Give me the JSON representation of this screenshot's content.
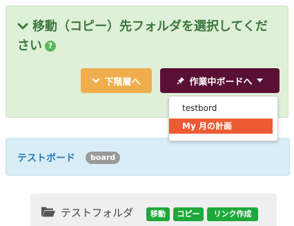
{
  "header": {
    "title": "移動（コピー）先フォルダを選択してください",
    "help": "?",
    "colors": {
      "panel": "#dff0d8",
      "title": "#3c763d"
    }
  },
  "buttons": {
    "down_level": "下階層へ",
    "to_board": "作業中ボードへ"
  },
  "dropdown": {
    "items": [
      "testbord",
      "My 月の計画"
    ],
    "active_index": 1
  },
  "board": {
    "name": "テストボード",
    "tag": "board"
  },
  "folder": {
    "name": "テストフォルダ",
    "actions": [
      "移動",
      "コピー",
      "リンク作成"
    ]
  },
  "icons": [
    "chevron-down-icon",
    "help-icon",
    "pin-icon",
    "caret-down-icon",
    "folder-open-icon"
  ]
}
